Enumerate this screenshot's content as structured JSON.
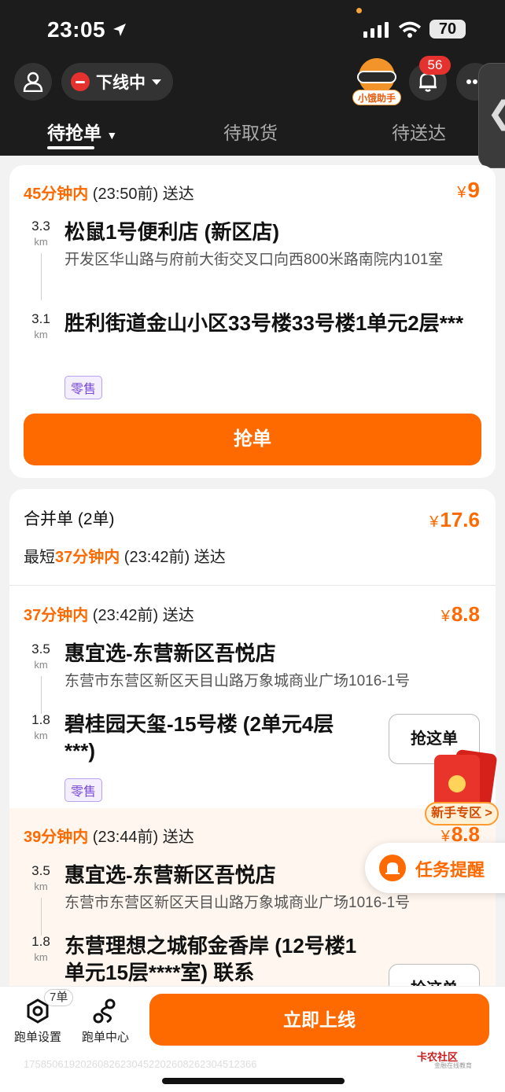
{
  "status_bar": {
    "time": "23:05",
    "battery": "70"
  },
  "header": {
    "status_label": "下线中",
    "helper_label": "小饿助手",
    "notifications": "56",
    "tabs": [
      "待抢单",
      "待取货",
      "待送达"
    ]
  },
  "order1": {
    "deadline_time": "45分钟内",
    "deadline_rest": " (23:50前) 送达",
    "price_symbol": "¥",
    "price": "9",
    "pickup_dist": "3.3",
    "pickup_unit": "km",
    "pickup_name": "松鼠1号便利店 (新区店)",
    "pickup_addr": "开发区华山路与府前大街交叉口向西800米路南院内101室",
    "drop_dist": "3.1",
    "drop_unit": "km",
    "drop_name": "胜利街道金山小区33号楼33号楼1单元2层***",
    "tag": "零售",
    "grab_label": "抢单"
  },
  "merged": {
    "title": "合并单 (2单)",
    "price_symbol": "¥",
    "price": "17.6",
    "shortest_prefix": "最短",
    "shortest_time": "37分钟内",
    "shortest_rest": " (23:42前) 送达",
    "orders": [
      {
        "deadline_time": "37分钟内",
        "deadline_rest": " (23:42前) 送达",
        "price_symbol": "¥",
        "price": "8.8",
        "pickup_dist": "3.5",
        "pickup_unit": "km",
        "pickup_name": "惠宜选-东营新区吾悦店",
        "pickup_addr": "东营市东营区新区天目山路万象城商业广场1016-1号",
        "drop_dist": "1.8",
        "drop_unit": "km",
        "drop_name": "碧桂园天玺-15号楼 (2单元4层***)",
        "tag": "零售",
        "grab_label": "抢这单"
      },
      {
        "deadline_time": "39分钟内",
        "deadline_rest": " (23:44前) 送达",
        "price_symbol": "¥",
        "price": "8.8",
        "pickup_dist": "3.5",
        "pickup_unit": "km",
        "pickup_name": "惠宜选-东营新区吾悦店",
        "pickup_addr": "东营市东营区新区天目山路万象城商业广场1016-1号",
        "drop_dist": "1.8",
        "drop_unit": "km",
        "drop_name": "东营理想之城郁金香岸 (12号楼1单元15层****室) 联系",
        "grab_label": "抢这单"
      }
    ]
  },
  "floating": {
    "newbie": "新手专区 >",
    "task": "任务提醒"
  },
  "bottom_bar": {
    "settings_label": "跑单设置",
    "settings_badge": "7单",
    "center_label": "跑单中心",
    "online_label": "立即上线",
    "watermark_brand": "卡农社区",
    "watermark_sub": "金融在线教育",
    "id_text": "17585061920260826230452202608262304512366"
  },
  "colors": {
    "accent": "#ff6a00",
    "header_bg": "#1c1c1c",
    "offline_red": "#e5322e",
    "tag_purple": "#7a4ad6"
  },
  "icons": [
    "location-arrow-icon",
    "signal-icon",
    "wifi-icon",
    "user-icon",
    "bell-icon",
    "more-icon",
    "chevron-left-icon",
    "caret-down-icon",
    "bell-task-icon",
    "settings-icon",
    "route-icon"
  ]
}
